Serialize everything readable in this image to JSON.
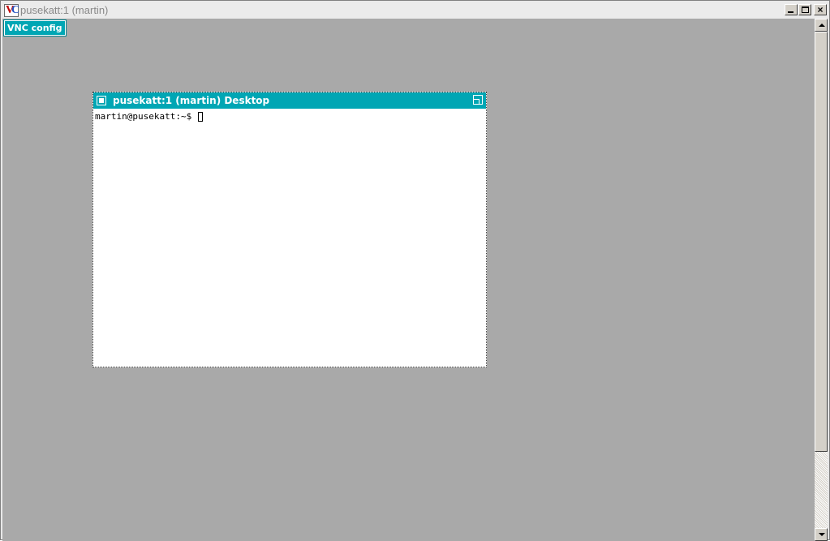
{
  "window": {
    "title": "pusekatt:1 (martin)",
    "icon": "vnc-icon",
    "icon_letters": {
      "v": "V",
      "c": "C"
    },
    "buttons": {
      "minimize": "minimize-icon",
      "maximize": "maximize-icon",
      "close": "×"
    }
  },
  "toolbar": {
    "vnc_config_label": "VNC config"
  },
  "remote_desktop": {
    "background": "#a9a9a9",
    "xterm": {
      "title": "pusekatt:1 (martin) Desktop",
      "prompt": "martin@pusekatt:~$ ",
      "accent": "#00a6b4"
    }
  },
  "scrollbar": {
    "up": "scroll-up-arrow",
    "down": "scroll-down-arrow"
  }
}
